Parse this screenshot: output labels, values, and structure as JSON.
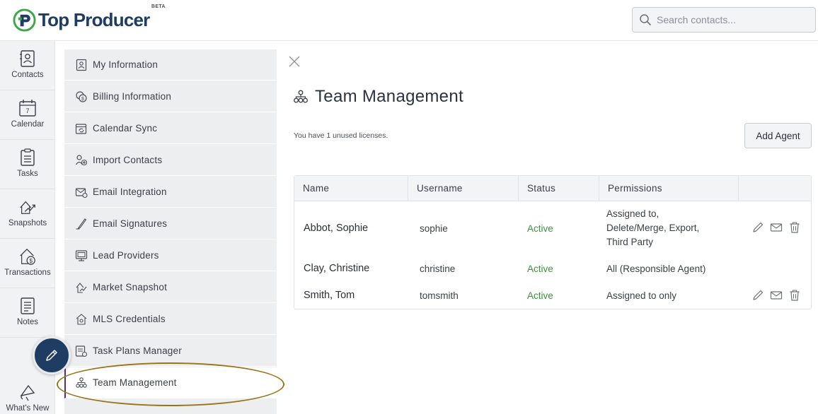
{
  "app": {
    "brand": "Top Producer",
    "beta": "BETA"
  },
  "search": {
    "placeholder": "Search contacts..."
  },
  "rail": [
    {
      "label": "Contacts",
      "icon": "contacts-icon"
    },
    {
      "label": "Calendar",
      "icon": "calendar-icon",
      "day": "7"
    },
    {
      "label": "Tasks",
      "icon": "tasks-icon"
    },
    {
      "label": "Snapshots",
      "icon": "snapshots-icon"
    },
    {
      "label": "Transactions",
      "icon": "transactions-icon"
    },
    {
      "label": "Notes",
      "icon": "notes-icon"
    },
    {
      "label": "What's New",
      "icon": "whats-new-icon"
    }
  ],
  "menu": [
    {
      "label": "My Information",
      "icon": "id-badge-icon"
    },
    {
      "label": "Billing Information",
      "icon": "billing-icon"
    },
    {
      "label": "Calendar Sync",
      "icon": "calendar-sync-icon"
    },
    {
      "label": "Import Contacts",
      "icon": "import-contacts-icon"
    },
    {
      "label": "Email Integration",
      "icon": "email-integration-icon"
    },
    {
      "label": "Email Signatures",
      "icon": "signature-icon"
    },
    {
      "label": "Lead Providers",
      "icon": "lead-providers-icon"
    },
    {
      "label": "Market Snapshot",
      "icon": "market-snapshot-icon"
    },
    {
      "label": "MLS Credentials",
      "icon": "mls-credentials-icon"
    },
    {
      "label": "Task Plans Manager",
      "icon": "task-plans-icon"
    },
    {
      "label": "Team Management",
      "icon": "team-icon",
      "active": true
    }
  ],
  "main": {
    "title": "Team Management",
    "licenses_text": "You have 1 unused licenses.",
    "add_agent_label": "Add Agent",
    "table": {
      "headers": [
        "Name",
        "Username",
        "Status",
        "Permissions",
        ""
      ],
      "rows": [
        {
          "name": "Abbot, Sophie",
          "username": "sophie",
          "status": "Active",
          "permissions": [
            "Assigned to,",
            "Delete/Merge, Export,",
            "Third Party"
          ],
          "actions": true
        },
        {
          "name": "Clay, Christine",
          "username": "christine",
          "status": "Active",
          "permissions": [
            "All (Responsible Agent)"
          ],
          "actions": false
        },
        {
          "name": "Smith, Tom",
          "username": "tomsmith",
          "status": "Active",
          "permissions": [
            "Assigned to only"
          ],
          "actions": true
        }
      ]
    }
  },
  "colors": {
    "brand_navy": "#1f3d63",
    "brand_green": "#3aa845",
    "status_active": "#3f8f3f",
    "highlight_ring": "#9a7416",
    "active_marker": "#5b2a86"
  }
}
